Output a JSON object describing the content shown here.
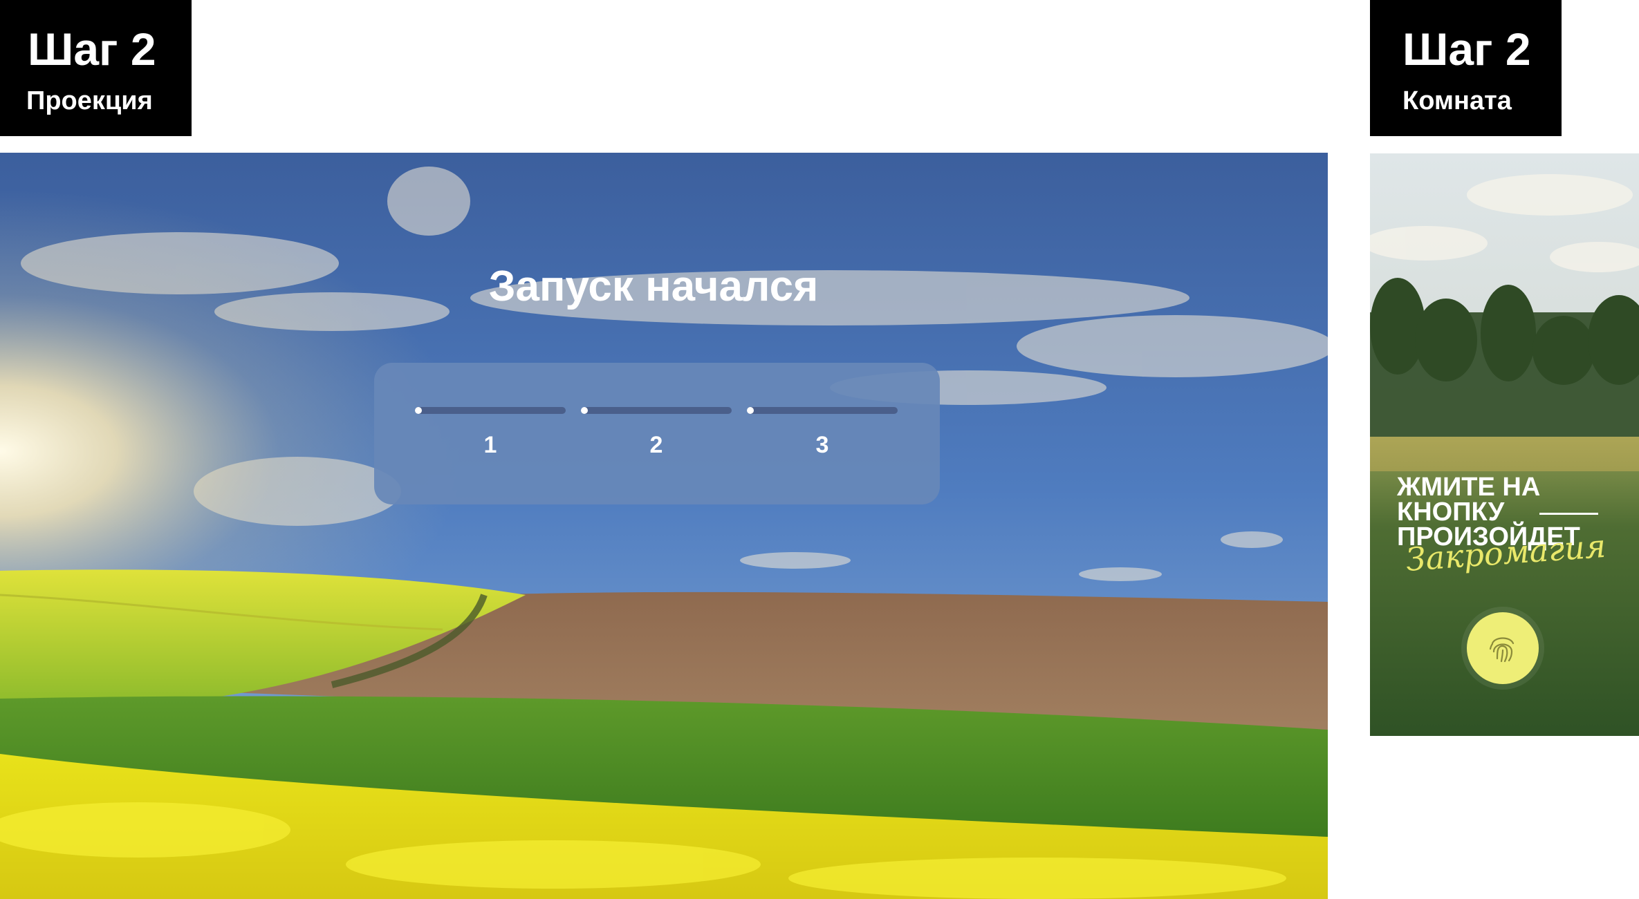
{
  "labels": {
    "left": {
      "step": "Шаг 2",
      "sub": "Проекция"
    },
    "right": {
      "step": "Шаг 2",
      "sub": "Комната"
    }
  },
  "projection": {
    "title": "Запуск начался",
    "steps": [
      {
        "label": "1",
        "progress": 0.03
      },
      {
        "label": "2",
        "progress": 0.03
      },
      {
        "label": "3",
        "progress": 0.03
      }
    ],
    "colors": {
      "panel": "#6788b8",
      "track": "#4a5f8b",
      "fill": "#ffffff"
    }
  },
  "room": {
    "headline": [
      "ЖМИТЕ НА",
      "КНОПКУ",
      "ПРОИЗОЙДЕТ"
    ],
    "script": "Закромагия",
    "button_icon": "fingerprint-icon",
    "colors": {
      "accent": "#eeee77",
      "script": "#e9e86a"
    }
  }
}
